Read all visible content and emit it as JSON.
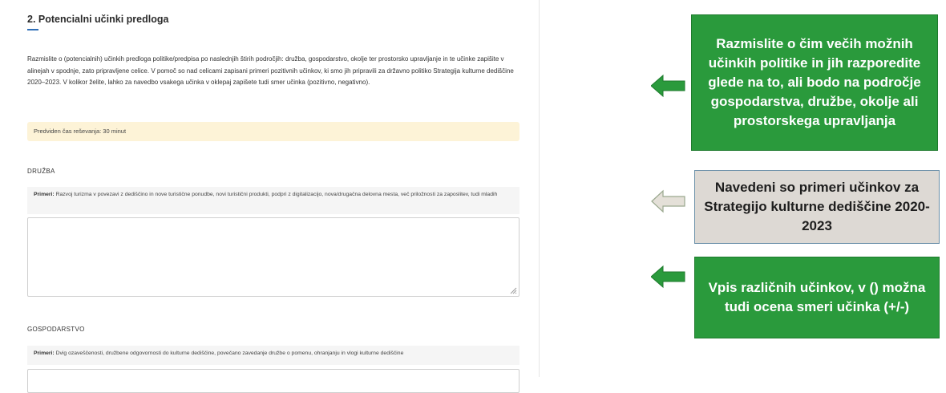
{
  "form": {
    "section_title": "2. Potencialni učinki predloga",
    "intro": "Razmislite o (potencialnih) učinkih predloga politike/predpisa po naslednjih štirih področjih: družba, gospodarstvo, okolje ter prostorsko upravljanje in te učinke zapišite v alinejah v spodnje, zato pripravljene celice. V pomoč so nad celicami zapisani primeri pozitivnih učinkov, ki smo jih pripravili za državno politiko Strategija kulturne dediščine 2020–2023. V kolikor želite, lahko za navedbo vsakega učinka v oklepaj zapišete tudi smer učinka (pozitivno, negativno).",
    "notice": "Predviden čas reševanja: 30 minut",
    "groups": [
      {
        "label": "DRUŽBA",
        "example_prefix": "Primeri:",
        "example_text": "Razvoj turizma v povezavi z dediščino in nove turistične ponudbe, novi turistični produkti, podpri z digitalizacijo, nova/drugačna delovna mesta, več priložnosti za zaposlitev, tudi mladih"
      },
      {
        "label": "GOSPODARSTVO",
        "example_prefix": "Primeri:",
        "example_text": "Dvig ozaveščenosti, družbene odgovornosti do kulturne dediščine, povečano zavedanje družbe o pomenu, ohranjanju in vlogi kulturne dediščine"
      }
    ]
  },
  "callouts": [
    {
      "text": "Razmislite o čim večih možnih učinkih politike in jih razporedite glede na to, ali bodo na področje gospodarstva, družbe, okolje ali prostorskega upravljanja",
      "arrow_icon": "arrow-left-green"
    },
    {
      "text": "Navedeni so primeri učinkov za Strategijo kulturne dediščine 2020-2023",
      "arrow_icon": "arrow-left-outline"
    },
    {
      "text": "Vpis različnih učinkov, v () možna tudi ocena smeri učinka (+/-)",
      "arrow_icon": "arrow-left-green"
    }
  ],
  "colors": {
    "accent_blue": "#2f6fb7",
    "callout_green": "#2a9a3c",
    "callout_grey": "#ddd9d4",
    "notice_bg": "#fdf3d7"
  }
}
